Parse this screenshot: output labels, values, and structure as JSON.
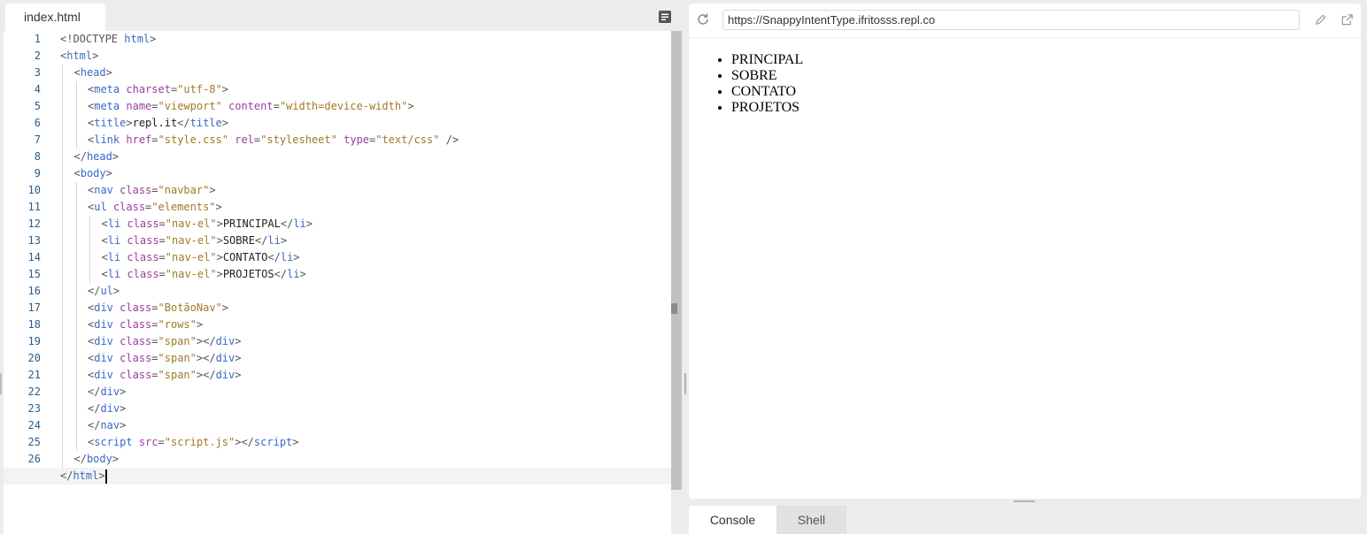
{
  "editor": {
    "tab_label": "index.html",
    "files_icon": "list-icon",
    "active_line": 27,
    "lines": [
      {
        "indent": 0,
        "tokens": [
          [
            "doc",
            "<!DOCTYPE "
          ],
          [
            "tag",
            "html"
          ],
          [
            "doc",
            ">"
          ]
        ]
      },
      {
        "indent": 0,
        "tokens": [
          [
            "punct",
            "<"
          ],
          [
            "tag",
            "html"
          ],
          [
            "punct",
            ">"
          ]
        ]
      },
      {
        "indent": 1,
        "tokens": [
          [
            "punct",
            "<"
          ],
          [
            "tag",
            "head"
          ],
          [
            "punct",
            ">"
          ]
        ]
      },
      {
        "indent": 2,
        "tokens": [
          [
            "punct",
            "<"
          ],
          [
            "tag",
            "meta"
          ],
          [
            "text",
            " "
          ],
          [
            "attr",
            "charset"
          ],
          [
            "punct",
            "="
          ],
          [
            "str",
            "\"utf-8\""
          ],
          [
            "punct",
            ">"
          ]
        ]
      },
      {
        "indent": 2,
        "tokens": [
          [
            "punct",
            "<"
          ],
          [
            "tag",
            "meta"
          ],
          [
            "text",
            " "
          ],
          [
            "attr",
            "name"
          ],
          [
            "punct",
            "="
          ],
          [
            "str",
            "\"viewport\""
          ],
          [
            "text",
            " "
          ],
          [
            "attr",
            "content"
          ],
          [
            "punct",
            "="
          ],
          [
            "str",
            "\"width=device-width\""
          ],
          [
            "punct",
            ">"
          ]
        ]
      },
      {
        "indent": 2,
        "tokens": [
          [
            "punct",
            "<"
          ],
          [
            "tag",
            "title"
          ],
          [
            "punct",
            ">"
          ],
          [
            "text",
            "repl.it"
          ],
          [
            "punct",
            "</"
          ],
          [
            "tag",
            "title"
          ],
          [
            "punct",
            ">"
          ]
        ]
      },
      {
        "indent": 2,
        "tokens": [
          [
            "punct",
            "<"
          ],
          [
            "tag",
            "link"
          ],
          [
            "text",
            " "
          ],
          [
            "attr",
            "href"
          ],
          [
            "punct",
            "="
          ],
          [
            "str",
            "\"style.css\""
          ],
          [
            "text",
            " "
          ],
          [
            "attr",
            "rel"
          ],
          [
            "punct",
            "="
          ],
          [
            "str",
            "\"stylesheet\""
          ],
          [
            "text",
            " "
          ],
          [
            "attr",
            "type"
          ],
          [
            "punct",
            "="
          ],
          [
            "str",
            "\"text/css\""
          ],
          [
            "text",
            " "
          ],
          [
            "punct",
            "/>"
          ]
        ]
      },
      {
        "indent": 1,
        "tokens": [
          [
            "punct",
            "</"
          ],
          [
            "tag",
            "head"
          ],
          [
            "punct",
            ">"
          ]
        ]
      },
      {
        "indent": 1,
        "tokens": [
          [
            "punct",
            "<"
          ],
          [
            "tag",
            "body"
          ],
          [
            "punct",
            ">"
          ]
        ]
      },
      {
        "indent": 2,
        "tokens": [
          [
            "punct",
            "<"
          ],
          [
            "tag",
            "nav"
          ],
          [
            "text",
            " "
          ],
          [
            "attr",
            "class"
          ],
          [
            "punct",
            "="
          ],
          [
            "str",
            "\"navbar\""
          ],
          [
            "punct",
            ">"
          ]
        ]
      },
      {
        "indent": 2,
        "tokens": [
          [
            "punct",
            "<"
          ],
          [
            "tag",
            "ul"
          ],
          [
            "text",
            " "
          ],
          [
            "attr",
            "class"
          ],
          [
            "punct",
            "="
          ],
          [
            "str",
            "\"elements\""
          ],
          [
            "punct",
            ">"
          ]
        ]
      },
      {
        "indent": 3,
        "tokens": [
          [
            "punct",
            "<"
          ],
          [
            "tag",
            "li"
          ],
          [
            "text",
            " "
          ],
          [
            "attr",
            "class"
          ],
          [
            "punct",
            "="
          ],
          [
            "str",
            "\"nav-el\""
          ],
          [
            "punct",
            ">"
          ],
          [
            "text",
            "PRINCIPAL"
          ],
          [
            "punct",
            "</"
          ],
          [
            "tag",
            "li"
          ],
          [
            "punct",
            ">"
          ]
        ]
      },
      {
        "indent": 3,
        "tokens": [
          [
            "punct",
            "<"
          ],
          [
            "tag",
            "li"
          ],
          [
            "text",
            " "
          ],
          [
            "attr",
            "class"
          ],
          [
            "punct",
            "="
          ],
          [
            "str",
            "\"nav-el\""
          ],
          [
            "punct",
            ">"
          ],
          [
            "text",
            "SOBRE"
          ],
          [
            "punct",
            "</"
          ],
          [
            "tag",
            "li"
          ],
          [
            "punct",
            ">"
          ]
        ]
      },
      {
        "indent": 3,
        "tokens": [
          [
            "punct",
            "<"
          ],
          [
            "tag",
            "li"
          ],
          [
            "text",
            " "
          ],
          [
            "attr",
            "class"
          ],
          [
            "punct",
            "="
          ],
          [
            "str",
            "\"nav-el\""
          ],
          [
            "punct",
            ">"
          ],
          [
            "text",
            "CONTATO"
          ],
          [
            "punct",
            "</"
          ],
          [
            "tag",
            "li"
          ],
          [
            "punct",
            ">"
          ]
        ]
      },
      {
        "indent": 3,
        "tokens": [
          [
            "punct",
            "<"
          ],
          [
            "tag",
            "li"
          ],
          [
            "text",
            " "
          ],
          [
            "attr",
            "class"
          ],
          [
            "punct",
            "="
          ],
          [
            "str",
            "\"nav-el\""
          ],
          [
            "punct",
            ">"
          ],
          [
            "text",
            "PROJETOS"
          ],
          [
            "punct",
            "</"
          ],
          [
            "tag",
            "li"
          ],
          [
            "punct",
            ">"
          ]
        ]
      },
      {
        "indent": 2,
        "tokens": [
          [
            "punct",
            "</"
          ],
          [
            "tag",
            "ul"
          ],
          [
            "punct",
            ">"
          ]
        ]
      },
      {
        "indent": 2,
        "tokens": [
          [
            "punct",
            "<"
          ],
          [
            "tag",
            "div"
          ],
          [
            "text",
            " "
          ],
          [
            "attr",
            "class"
          ],
          [
            "punct",
            "="
          ],
          [
            "str",
            "\"BotãoNav\""
          ],
          [
            "punct",
            ">"
          ]
        ]
      },
      {
        "indent": 2,
        "tokens": [
          [
            "punct",
            "<"
          ],
          [
            "tag",
            "div"
          ],
          [
            "text",
            " "
          ],
          [
            "attr",
            "class"
          ],
          [
            "punct",
            "="
          ],
          [
            "str",
            "\"rows\""
          ],
          [
            "punct",
            ">"
          ]
        ]
      },
      {
        "indent": 2,
        "tokens": [
          [
            "punct",
            "<"
          ],
          [
            "tag",
            "div"
          ],
          [
            "text",
            " "
          ],
          [
            "attr",
            "class"
          ],
          [
            "punct",
            "="
          ],
          [
            "str",
            "\"span\""
          ],
          [
            "punct",
            "></"
          ],
          [
            "tag",
            "div"
          ],
          [
            "punct",
            ">"
          ]
        ]
      },
      {
        "indent": 2,
        "tokens": [
          [
            "punct",
            "<"
          ],
          [
            "tag",
            "div"
          ],
          [
            "text",
            " "
          ],
          [
            "attr",
            "class"
          ],
          [
            "punct",
            "="
          ],
          [
            "str",
            "\"span\""
          ],
          [
            "punct",
            "></"
          ],
          [
            "tag",
            "div"
          ],
          [
            "punct",
            ">"
          ]
        ]
      },
      {
        "indent": 2,
        "tokens": [
          [
            "punct",
            "<"
          ],
          [
            "tag",
            "div"
          ],
          [
            "text",
            " "
          ],
          [
            "attr",
            "class"
          ],
          [
            "punct",
            "="
          ],
          [
            "str",
            "\"span\""
          ],
          [
            "punct",
            "></"
          ],
          [
            "tag",
            "div"
          ],
          [
            "punct",
            ">"
          ]
        ]
      },
      {
        "indent": 2,
        "tokens": [
          [
            "punct",
            "</"
          ],
          [
            "tag",
            "div"
          ],
          [
            "punct",
            ">"
          ]
        ]
      },
      {
        "indent": 2,
        "tokens": [
          [
            "punct",
            "</"
          ],
          [
            "tag",
            "div"
          ],
          [
            "punct",
            ">"
          ]
        ]
      },
      {
        "indent": 2,
        "tokens": [
          [
            "punct",
            "</"
          ],
          [
            "tag",
            "nav"
          ],
          [
            "punct",
            ">"
          ]
        ]
      },
      {
        "indent": 2,
        "tokens": [
          [
            "punct",
            "<"
          ],
          [
            "tag",
            "script"
          ],
          [
            "text",
            " "
          ],
          [
            "attr",
            "src"
          ],
          [
            "punct",
            "="
          ],
          [
            "str",
            "\"script.js\""
          ],
          [
            "punct",
            "></"
          ],
          [
            "tag",
            "script"
          ],
          [
            "punct",
            ">"
          ]
        ]
      },
      {
        "indent": 1,
        "tokens": [
          [
            "punct",
            "</"
          ],
          [
            "tag",
            "body"
          ],
          [
            "punct",
            ">"
          ]
        ]
      },
      {
        "indent": 0,
        "tokens": [
          [
            "punct",
            "</"
          ],
          [
            "tag",
            "html"
          ],
          [
            "punct",
            ">"
          ]
        ]
      }
    ],
    "colors": {
      "tag": "#3a68c8",
      "attr": "#9a3fa0",
      "string": "#a17a25",
      "line_number": "#2b5d8a"
    }
  },
  "browser": {
    "reload_icon": "reload-icon",
    "url": "https://SnappyIntentType.ifritosss.repl.co",
    "edit_icon": "pencil-icon",
    "open_icon": "external-link-icon",
    "preview_items": [
      "PRINCIPAL",
      "SOBRE",
      "CONTATO",
      "PROJETOS"
    ]
  },
  "bottom_tabs": {
    "console_label": "Console",
    "shell_label": "Shell",
    "active": "Console"
  }
}
